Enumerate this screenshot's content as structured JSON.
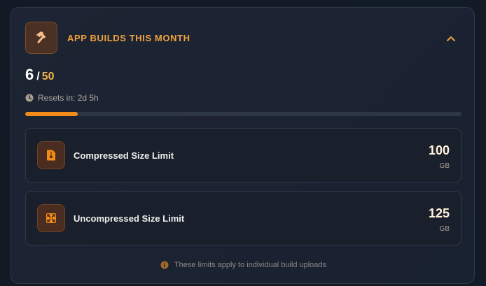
{
  "colors": {
    "accent": "#f08c17",
    "title": "#f2a23d",
    "total": "#f0b24a",
    "background": "#121a26",
    "card": "#1d2433",
    "track": "#2c3646"
  },
  "header": {
    "icon": "hammer-icon",
    "title": "APP BUILDS THIS MONTH",
    "collapse_icon": "chevron-up-icon"
  },
  "usage": {
    "current": "6",
    "separator": "/",
    "total": "50",
    "progress_fraction": 0.12,
    "reset_icon": "clock-icon",
    "reset_text": "Resets in: 2d 5h"
  },
  "limits": [
    {
      "icon": "compressed-file-icon",
      "label": "Compressed Size Limit",
      "value": "100",
      "unit": "GB"
    },
    {
      "icon": "expand-icon",
      "label": "Uncompressed Size Limit",
      "value": "125",
      "unit": "GB"
    }
  ],
  "footer": {
    "icon": "info-icon",
    "text": "These limits apply to individual build uploads"
  }
}
